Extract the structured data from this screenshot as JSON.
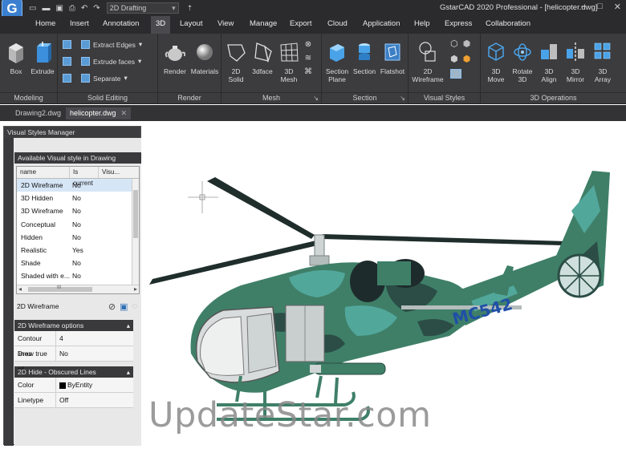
{
  "app": {
    "logo_letter": "G",
    "title": "GstarCAD 2020 Professional - [helicopter.dwg]",
    "workspace": "2D Drafting"
  },
  "menu_tabs": [
    "Home",
    "Insert",
    "Annotation",
    "3D",
    "Layout",
    "View",
    "Manage",
    "Export",
    "Cloud",
    "Application",
    "Help",
    "Express",
    "Collaboration"
  ],
  "active_tab": "3D",
  "ribbon": {
    "modeling": {
      "label": "Modeling",
      "box": "Box",
      "extrude": "Extrude"
    },
    "solid_editing": {
      "label": "Solid Editing",
      "extract_edges": "Extract Edges",
      "extrude_faces": "Extrude faces",
      "separate": "Separate"
    },
    "render": {
      "label": "Render",
      "render": "Render",
      "materials": "Materials"
    },
    "mesh": {
      "label": "Mesh",
      "solid_2d": "2D Solid",
      "face_3d": "3dface",
      "mesh_3d": "3D Mesh"
    },
    "section": {
      "label": "Section",
      "section_plane": "Section Plane",
      "section": "Section",
      "flatshot": "Flatshot"
    },
    "visual_styles": {
      "label": "Visual Styles",
      "wireframe_2d": "2D Wireframe"
    },
    "operations_3d": {
      "label": "3D Operations",
      "move": "3D Move",
      "rotate": "Rotate 3D",
      "align": "3D Align",
      "mirror": "3D Mirror",
      "array": "3D Array"
    }
  },
  "doc_tabs": [
    "Drawing2.dwg",
    "helicopter.dwg"
  ],
  "palette": {
    "title": "Visual Styles Manager",
    "available_header": "Available Visual style in Drawing",
    "columns": [
      "name",
      "Is current",
      "Visu..."
    ],
    "styles": [
      {
        "name": "2D Wireframe",
        "current": "No"
      },
      {
        "name": "3D Hidden",
        "current": "No"
      },
      {
        "name": "3D Wireframe",
        "current": "No"
      },
      {
        "name": "Conceptual",
        "current": "No"
      },
      {
        "name": "Hidden",
        "current": "No"
      },
      {
        "name": "Realistic",
        "current": "Yes"
      },
      {
        "name": "Shade",
        "current": "No"
      },
      {
        "name": "Shaded with e...",
        "current": "No"
      }
    ],
    "hscroll_label": "III",
    "selected_style": "2D Wireframe",
    "wireframe_options": {
      "title": "2D Wireframe options",
      "contour_lines_label": "Contour lines",
      "contour_lines_value": "4",
      "draw_true_label": "Draw true sil...",
      "draw_true_value": "No"
    },
    "hide_obscured": {
      "title": "2D Hide - Obscured Lines",
      "color_label": "Color",
      "color_value": "ByEntity",
      "linetype_label": "Linetype",
      "linetype_value": "Off"
    }
  },
  "model": {
    "tail_text": "MC542"
  },
  "watermark": "UpdateStar.com",
  "colors": {
    "ribbon_bg": "#3c3c3f",
    "title_bg": "#2b2b2d",
    "helicopter_main": "#3f7f68",
    "helicopter_camo_light": "#52a79b",
    "helicopter_camo_dark": "#2b4d45"
  }
}
